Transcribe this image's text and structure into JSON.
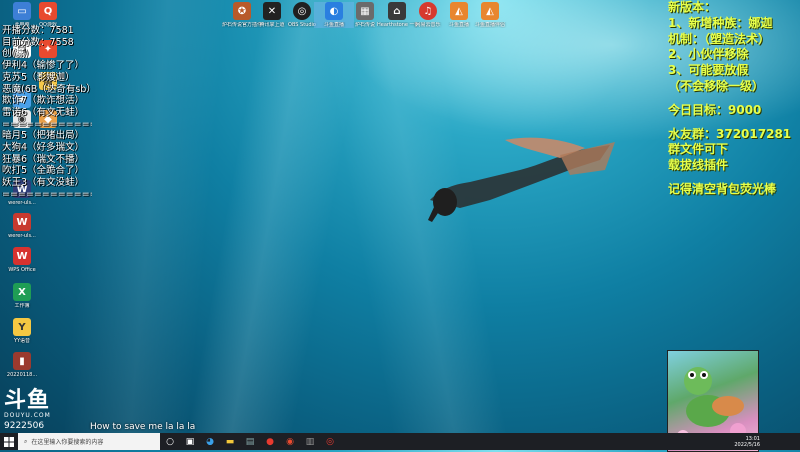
{
  "desktop_icons_left": [
    {
      "label": "此电脑",
      "icon": "computer-icon",
      "color": "#3d7fd6"
    },
    {
      "label": "QQ游戏",
      "icon": "qq-game-icon",
      "color": "#e84a2f"
    },
    {
      "label": "",
      "icon": "app-icon",
      "color": "#ffffff"
    },
    {
      "label": "",
      "icon": "app-icon",
      "color": "#f5c84a"
    },
    {
      "label": "",
      "icon": "app-icon",
      "color": "#4aa0e8"
    },
    {
      "label": "",
      "icon": "app-icon",
      "color": "#4aa0e8"
    },
    {
      "label": "",
      "icon": "app-icon",
      "color": "#e8e8e8"
    },
    {
      "label": "",
      "icon": "app-icon",
      "color": "#e8a04a"
    },
    {
      "label": "werer-uls...",
      "icon": "app-icon",
      "color": "#2f3e7a"
    },
    {
      "label": "werer-uls...",
      "icon": "app-icon",
      "color": "#c83a2f"
    },
    {
      "label": "WPS Office",
      "icon": "wps-icon",
      "color": "#d6322f"
    },
    {
      "label": "工作簿",
      "icon": "spreadsheet-icon",
      "color": "#1f9d55"
    },
    {
      "label": "YY语音",
      "icon": "yy-icon",
      "color": "#f5c842"
    },
    {
      "label": "20220118...",
      "icon": "file-icon",
      "color": "#9b3a2f"
    }
  ],
  "desktop_icons_top": [
    {
      "label": "炉石传说官方插件",
      "icon": "hearthstone-icon",
      "color": "#b85a2a"
    },
    {
      "label": "腾讯掌上道",
      "icon": "app-icon",
      "color": "#222222"
    },
    {
      "label": "OBS Studio",
      "icon": "obs-icon",
      "color": "#202020"
    },
    {
      "label": "斗鱼直播",
      "icon": "douyu-icon",
      "color": "#2a7fe0"
    },
    {
      "label": "炉石传说",
      "icon": "hearthstone-icon",
      "color": "#6b6b6b"
    },
    {
      "label": "Hearthstone 一键启动",
      "icon": "app-icon",
      "color": "#3a3a3a"
    },
    {
      "label": "网易云音乐",
      "icon": "netease-music-icon",
      "color": "#d63a2f"
    },
    {
      "label": "斗鱼直播",
      "icon": "douyu-icon",
      "color": "#e8862f"
    },
    {
      "label": "斗鱼直播伴侣",
      "icon": "douyu-icon",
      "color": "#e8862f"
    }
  ],
  "left_overlay": {
    "lines": [
      "开播分数：7581",
      "目前分数：7558",
      "创(赢)",
      "伊利4（输惨了了）",
      "克苏5（影嫂迦）",
      "恶魔(6B（达奇有sb）",
      "欺诈7（欺诈想活）",
      "雷诺6（有文无蛙）",
      "================",
      "暗月5（把猪出局）",
      "大狗4（好多瑞文）",
      "狂暴6（瑞文不播）",
      "吹打5（全跪合了）",
      "妖王3（有文没蛙）",
      "================"
    ]
  },
  "right_overlay": {
    "lines": [
      "新版本：",
      "1、新增种族：娜迦",
      "机制：（塑造法术）",
      "2、小伙伴移除",
      "3、可能要放假",
      "（不会移除一级）",
      "",
      "今日目标：9000",
      "",
      "水友群：372017281",
      "群文件可下",
      "载拔线插件",
      "",
      "记得清空背包荧光棒"
    ]
  },
  "watermark": {
    "brand": "斗鱼",
    "site": "DOUYU.COM",
    "room": "9222506"
  },
  "song": "How to save me la la la",
  "taskbar": {
    "search_placeholder": "在这里输入你要搜索的内容",
    "time": "13:01",
    "date": "2022/5/16"
  },
  "colors": {
    "overlay_yellow": "#e7ff4a",
    "taskbar": "#1d1f24"
  }
}
